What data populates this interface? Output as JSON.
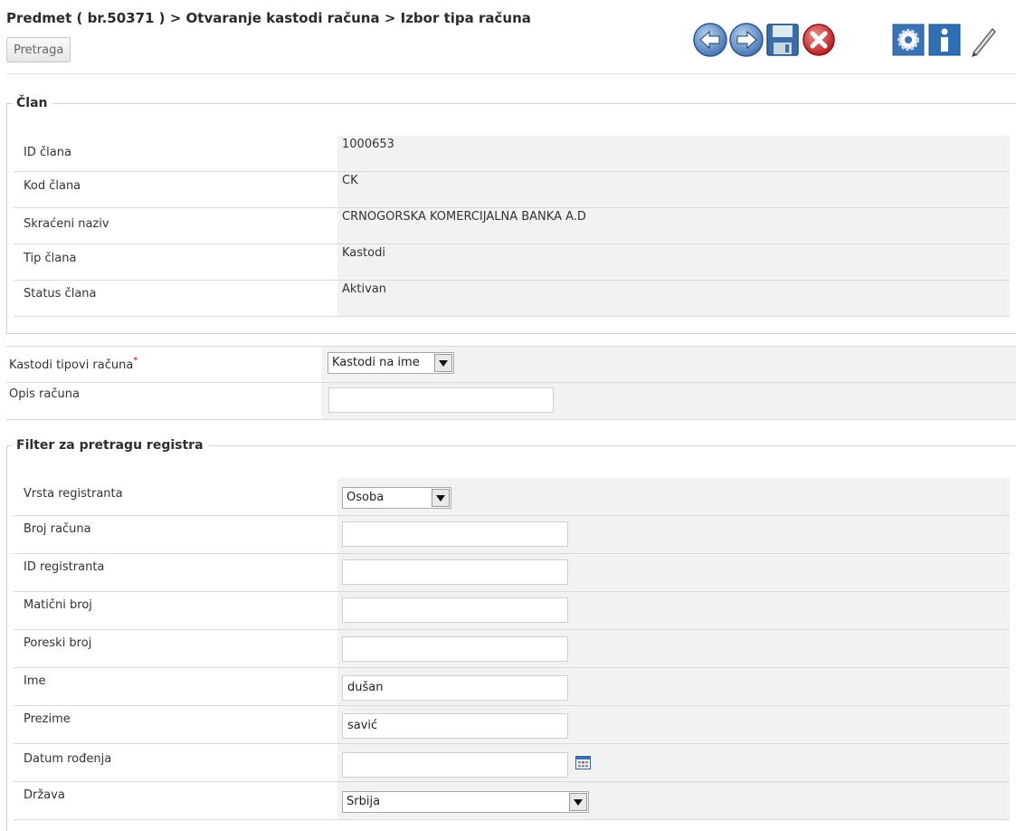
{
  "header": {
    "breadcrumb": "Predmet ( br.50371 ) > Otvaranje kastodi računa > Izbor tipa računa",
    "search_button": "Pretraga"
  },
  "toolbar": {
    "icons": [
      "back-icon",
      "forward-icon",
      "save-icon",
      "cancel-icon",
      "settings-icon",
      "info-icon",
      "edit-pen-icon"
    ]
  },
  "member_section": {
    "legend": "Član",
    "rows": [
      {
        "label": "ID člana",
        "value": "1000653"
      },
      {
        "label": "Kod člana",
        "value": "CK"
      },
      {
        "label": "Skraćeni naziv",
        "value": "CRNOGORSKA KOMERCIJALNA BANKA A.D"
      },
      {
        "label": "Tip člana",
        "value": "Kastodi"
      },
      {
        "label": "Status člana",
        "value": "Aktivan"
      }
    ]
  },
  "account": {
    "type_label": "Kastodi tipovi računa",
    "required_mark": "*",
    "type_value": "Kastodi na ime",
    "desc_label": "Opis računa",
    "desc_value": ""
  },
  "filter_section": {
    "legend": "Filter za pretragu registra",
    "registrant_type_label": "Vrsta registranta",
    "registrant_type_value": "Osoba",
    "account_number_label": "Broj računa",
    "account_number_value": "",
    "registrant_id_label": "ID registranta",
    "registrant_id_value": "",
    "reg_number_label": "Matični broj",
    "reg_number_value": "",
    "tax_number_label": "Poreski broj",
    "tax_number_value": "",
    "first_name_label": "Ime",
    "first_name_value": "dušan",
    "last_name_label": "Prezime",
    "last_name_value": "savić",
    "birth_date_label": "Datum rođenja",
    "birth_date_value": "",
    "country_label": "Država",
    "country_value": "Srbija"
  }
}
